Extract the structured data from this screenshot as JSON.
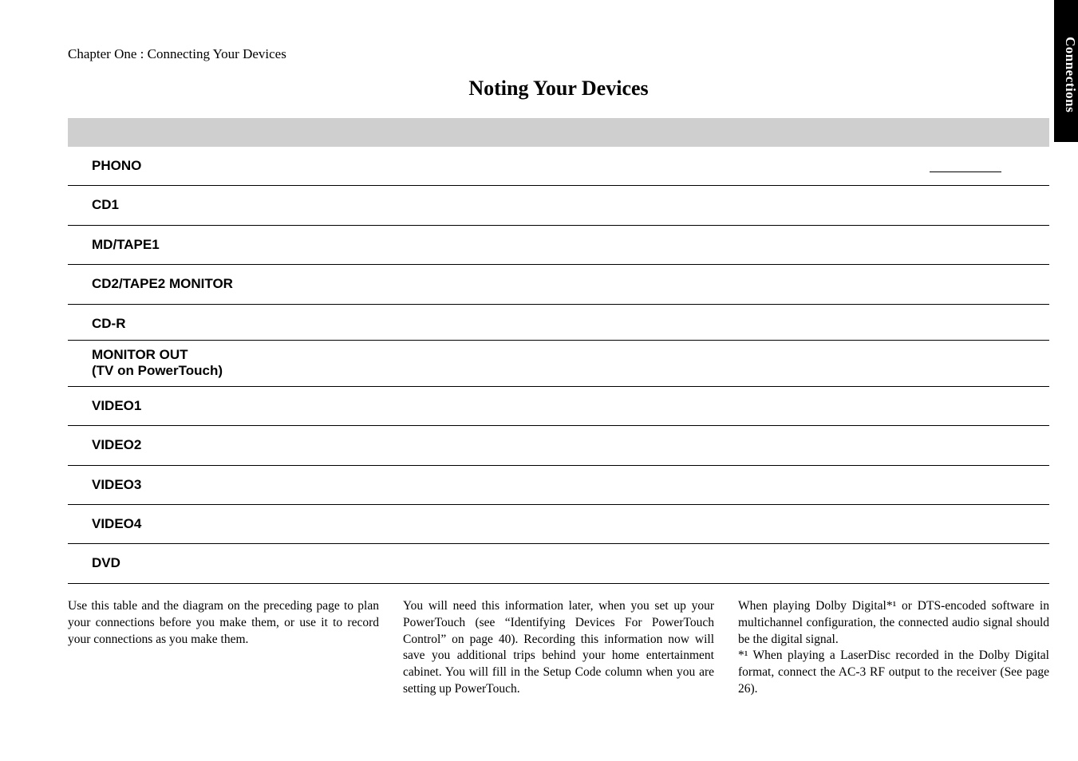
{
  "chapter_heading": "Chapter One : Connecting Your Devices",
  "page_title": "Noting Your Devices",
  "side_tab": "Connections",
  "rows": {
    "phono": "PHONO",
    "cd1": "CD1",
    "md_tape1": "MD/TAPE1",
    "cd2_tape2_monitor": "CD2/TAPE2 MONITOR",
    "cd_r": "CD-R",
    "monitor_out_line1": "MONITOR OUT",
    "monitor_out_line2": "(TV on PowerTouch)",
    "video1": "VIDEO1",
    "video2": "VIDEO2",
    "video3": "VIDEO3",
    "video4": "VIDEO4",
    "dvd": "DVD"
  },
  "body_text": {
    "col1": "Use this table and the diagram on the preceding page to plan your connections before you make them, or use it to record your connections as you make them.",
    "col2": "You will need this information later, when you set up your PowerTouch (see “Identifying Devices For PowerTouch Control” on page 40). Recording this information now will save you additional trips behind your home entertainment cabinet. You will fill in the Setup Code column when you are setting up PowerTouch.",
    "col3": "When playing Dolby Digital*¹ or DTS-encoded software in multichannel configuration, the connected audio signal should be the digital signal.",
    "col3_footnote": "*¹ When playing a LaserDisc recorded in the Dolby Digital format, connect the AC-3 RF output to the receiver (See page 26)."
  }
}
